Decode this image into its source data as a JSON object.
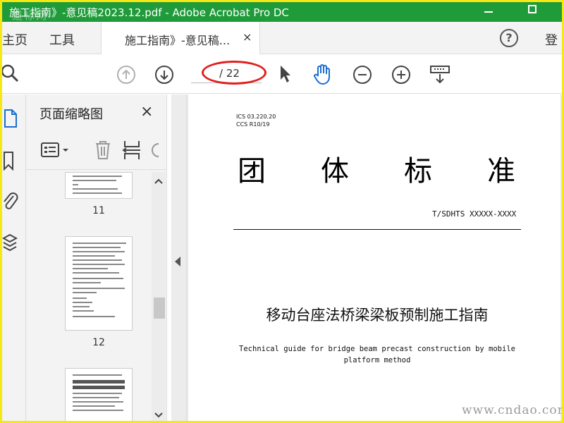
{
  "window": {
    "title": "施工指南》-意见稿2023.12.pdf - Adobe Acrobat Pro DC",
    "watermark": "道标网"
  },
  "menu": {
    "home": "主页",
    "tools": "工具",
    "doc_tab": "施工指南》-意见稿...",
    "close_tab": "×",
    "help": "?",
    "login": "登"
  },
  "toolbar": {
    "page_total": "/ 22"
  },
  "thumbnails": {
    "panel_title": "页面缩略图",
    "close": "×",
    "pages": [
      {
        "label": "11"
      },
      {
        "label": "12"
      }
    ]
  },
  "document": {
    "ics_line1": "ICS 03.220.20",
    "ics_line2": "CCS R10/19",
    "title_chars": [
      "团",
      "体",
      "标",
      "准"
    ],
    "standard_code": "T/SDHTS  XXXXX-XXXX",
    "cn_title": "移动台座法桥梁梁板预制施工指南",
    "en_title": "Technical guide for bridge beam precast construction by mobile platform method"
  },
  "site_watermark": "www.cndao.com",
  "colors": {
    "title_bar": "#1f9b3a",
    "outer_border": "#f5e814",
    "annotation_oval": "#e02020",
    "hand_tool_active": "#1a6fd1"
  }
}
